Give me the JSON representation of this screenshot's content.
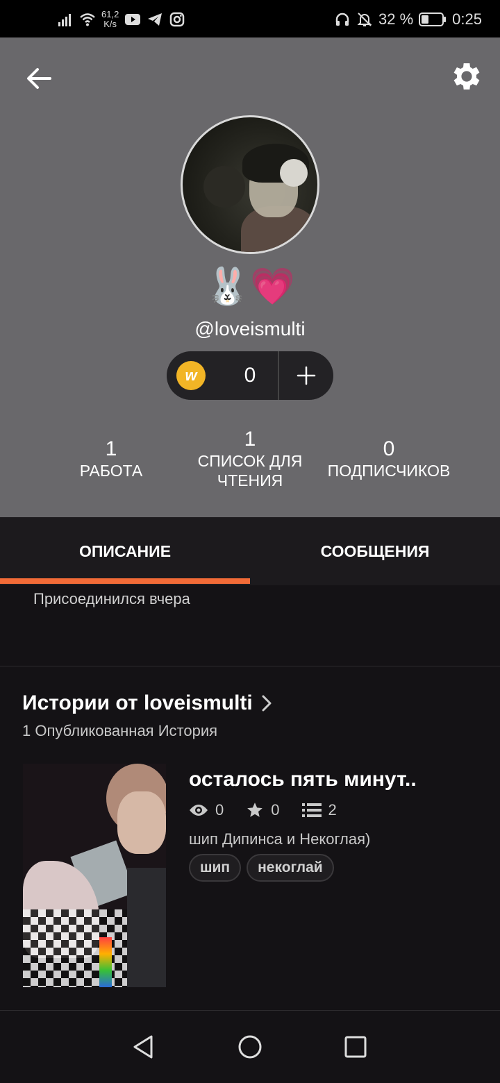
{
  "status_bar": {
    "net_speed_value": "61,2",
    "net_speed_unit": "K/s",
    "battery_percent": "32 %",
    "time": "0:25"
  },
  "profile": {
    "emojis": "🐰💗",
    "username": "@loveismulti",
    "coins": "0",
    "stats": [
      {
        "value": "1",
        "label": "РАБОТА"
      },
      {
        "value": "1",
        "label": "СПИСОК ДЛЯ ЧТЕНИЯ"
      },
      {
        "value": "0",
        "label": "ПОДПИСЧИКОВ"
      }
    ]
  },
  "tabs": [
    {
      "label": "ОПИСАНИЕ",
      "active": true
    },
    {
      "label": "СООБЩЕНИЯ",
      "active": false
    }
  ],
  "about": {
    "joined": "Присоединился вчера"
  },
  "stories": {
    "title": "Истории от loveismulti",
    "subtitle": "1 Опубликованная История",
    "items": [
      {
        "title": "осталось пять минут..",
        "views": "0",
        "votes": "0",
        "parts": "2",
        "description": "шип Дипинса и Некоглая)",
        "tags": [
          "шип",
          "некоглай"
        ]
      }
    ]
  },
  "colors": {
    "accent": "#f26b37",
    "header_bg": "#69686b",
    "page_bg": "#141215",
    "coin": "#f2b526"
  }
}
